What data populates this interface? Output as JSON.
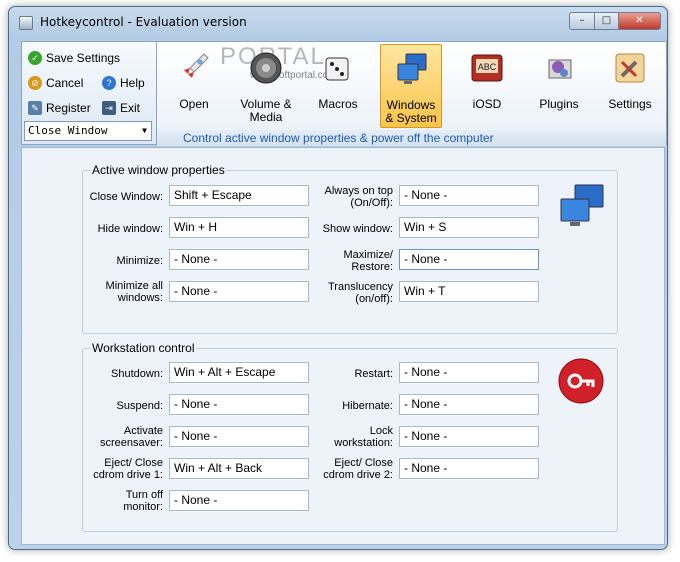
{
  "window": {
    "title": "Hotkeycontrol - Evaluation version"
  },
  "controls": {
    "minimize": "–",
    "maximize": "□",
    "close": "✕"
  },
  "left_panel": {
    "save": "Save Settings",
    "cancel": "Cancel",
    "help": "Help",
    "register": "Register",
    "exit": "Exit",
    "combo_value": "Close Window"
  },
  "toolbar": {
    "items": [
      {
        "label": "Open",
        "icon": "rocket-icon"
      },
      {
        "label": "Volume & Media",
        "icon": "speaker-icon"
      },
      {
        "label": "Macros",
        "icon": "dice-icon"
      },
      {
        "label": "Windows & System",
        "icon": "monitors-icon",
        "active": true
      },
      {
        "label": "iOSD",
        "icon": "abc-icon"
      },
      {
        "label": "Plugins",
        "icon": "puzzle-icon"
      },
      {
        "label": "Settings",
        "icon": "tools-icon"
      }
    ],
    "status": "Control active window properties & power off the computer",
    "watermark": "PORTAL",
    "watermark_sub": "www.softportal.com"
  },
  "active_window": {
    "title": "Active window properties",
    "left": [
      {
        "label": "Close Window:",
        "value": "Shift + Escape"
      },
      {
        "label": "Hide window:",
        "value": "Win + H"
      },
      {
        "label": "Minimize:",
        "value": "- None -"
      },
      {
        "label": "Minimize all windows:",
        "value": "- None -"
      }
    ],
    "right": [
      {
        "label": "Always on top (On/Off):",
        "value": "- None -"
      },
      {
        "label": "Show window:",
        "value": "Win + S"
      },
      {
        "label": "Maximize/ Restore:",
        "value": "- None -"
      },
      {
        "label": "Translucency (on/off):",
        "value": "Win + T"
      }
    ]
  },
  "workstation": {
    "title": "Workstation control",
    "left": [
      {
        "label": "Shutdown:",
        "value": "Win + Alt + Escape"
      },
      {
        "label": "Suspend:",
        "value": "- None -"
      },
      {
        "label": "Activate screensaver:",
        "value": "- None -"
      },
      {
        "label": "Eject/ Close cdrom drive 1:",
        "value": "Win + Alt + Back"
      },
      {
        "label": "Turn off monitor:",
        "value": "- None -"
      }
    ],
    "right": [
      {
        "label": "Restart:",
        "value": "- None -"
      },
      {
        "label": "Hibernate:",
        "value": "- None -"
      },
      {
        "label": "Lock workstation:",
        "value": "- None -"
      },
      {
        "label": "Eject/ Close cdrom drive 2:",
        "value": "- None -"
      }
    ]
  },
  "colors": {
    "accent": "#1e5bb5",
    "active_tab": "#f9c44a",
    "power_icon": "#d0202a"
  }
}
